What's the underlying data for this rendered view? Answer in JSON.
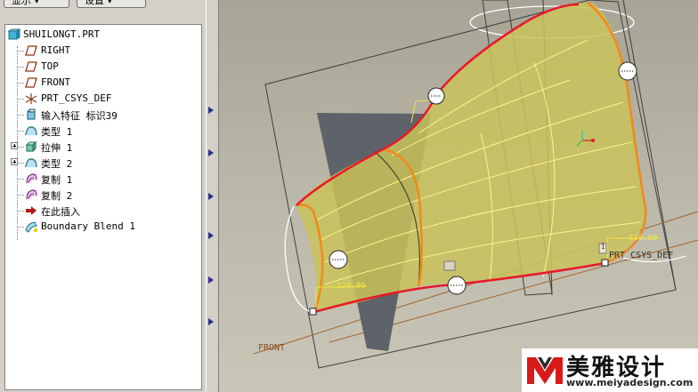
{
  "toolbar": {
    "show_label": "显示 ▾",
    "settings_label": "设置 ▾"
  },
  "tree": {
    "root": "SHUILONGT.PRT",
    "items": [
      {
        "label": "RIGHT",
        "icon": "datum-plane-icon"
      },
      {
        "label": "TOP",
        "icon": "datum-plane-icon"
      },
      {
        "label": "FRONT",
        "icon": "datum-plane-icon"
      },
      {
        "label": "PRT_CSYS_DEF",
        "icon": "coordinate-system-icon"
      },
      {
        "label": "输入特征 标识39",
        "icon": "import-feature-icon"
      },
      {
        "label": "类型 1",
        "icon": "style-feature-icon"
      },
      {
        "label": "拉伸 1",
        "icon": "extrude-icon"
      },
      {
        "label": "类型 2",
        "icon": "style-feature-icon"
      },
      {
        "label": "复制 1",
        "icon": "copy-surface-icon"
      },
      {
        "label": "复制 2",
        "icon": "copy-surface-icon"
      },
      {
        "label": "在此插入",
        "icon": "insert-here-arrow-icon"
      },
      {
        "label": "Boundary Blend 1",
        "icon": "boundary-blend-icon"
      }
    ]
  },
  "viewport": {
    "label_front": "FRONT",
    "label_csys": "PRT_CSYS_DEF",
    "dim_left": "120.00",
    "dim_right": "120.00",
    "tag_number": "1"
  },
  "watermark": {
    "brand": "美雅设计",
    "url": "www.meiyadesign.com"
  },
  "colors": {
    "panel": "#d4d0c8",
    "surface": "#c9c25a",
    "boundary_red": "#e8182a",
    "boundary_orange": "#f08a1a",
    "plane_slate": "#5d6368"
  }
}
